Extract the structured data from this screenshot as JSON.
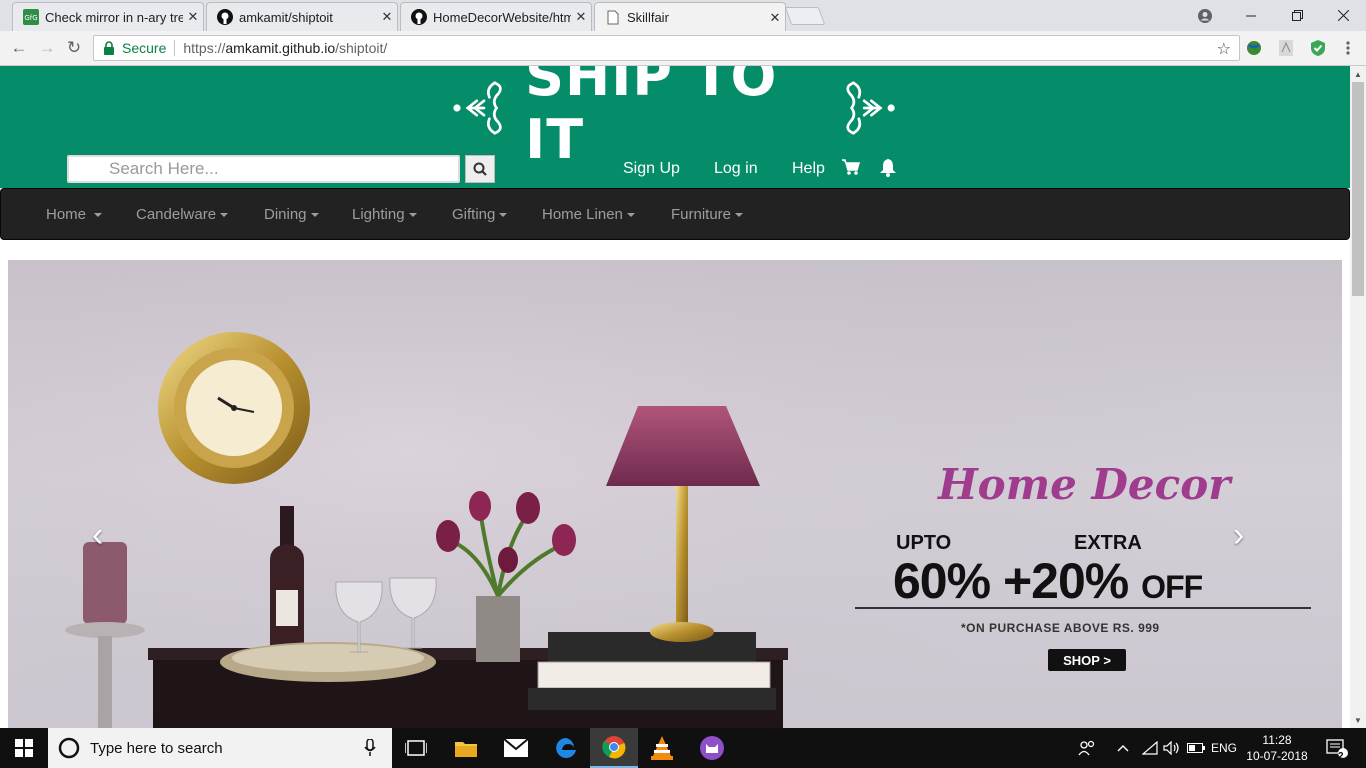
{
  "browser": {
    "tabs": [
      {
        "title": "Check mirror in n-ary tree",
        "favicon": "gfg-icon"
      },
      {
        "title": "amkamit/shiptoit",
        "favicon": "github-icon"
      },
      {
        "title": "HomeDecorWebsite/html",
        "favicon": "github-icon"
      },
      {
        "title": "Skillfair",
        "favicon": "page-icon"
      }
    ],
    "active_tab": 3,
    "secure_label": "Secure",
    "url_scheme": "https://",
    "url_host": "amkamit.github.io",
    "url_path": "/shiptoit/"
  },
  "site": {
    "logo_text": "SHIP TO IT",
    "search_placeholder": "Search Here...",
    "header_links": [
      "Sign Up",
      "Log in",
      "Help"
    ],
    "nav": [
      "Home",
      "Candelware",
      "Dining",
      "Lighting",
      "Gifting",
      "Home Linen",
      "Furniture"
    ],
    "colors": {
      "header_bg": "#058c68",
      "nav_bg": "#222222",
      "promo_accent": "#a03c8e"
    }
  },
  "hero": {
    "title": "Home Decor",
    "upto_label": "UPTO",
    "extra_label": "EXTRA",
    "discount_main": "60%",
    "discount_extra": "+20%",
    "off_label": "OFF",
    "note": "*ON PURCHASE ABOVE RS. 999",
    "cta": "SHOP >"
  },
  "taskbar": {
    "search_placeholder": "Type here to search",
    "language": "ENG",
    "time": "11:28",
    "date": "10-07-2018",
    "notification_count": "2"
  }
}
